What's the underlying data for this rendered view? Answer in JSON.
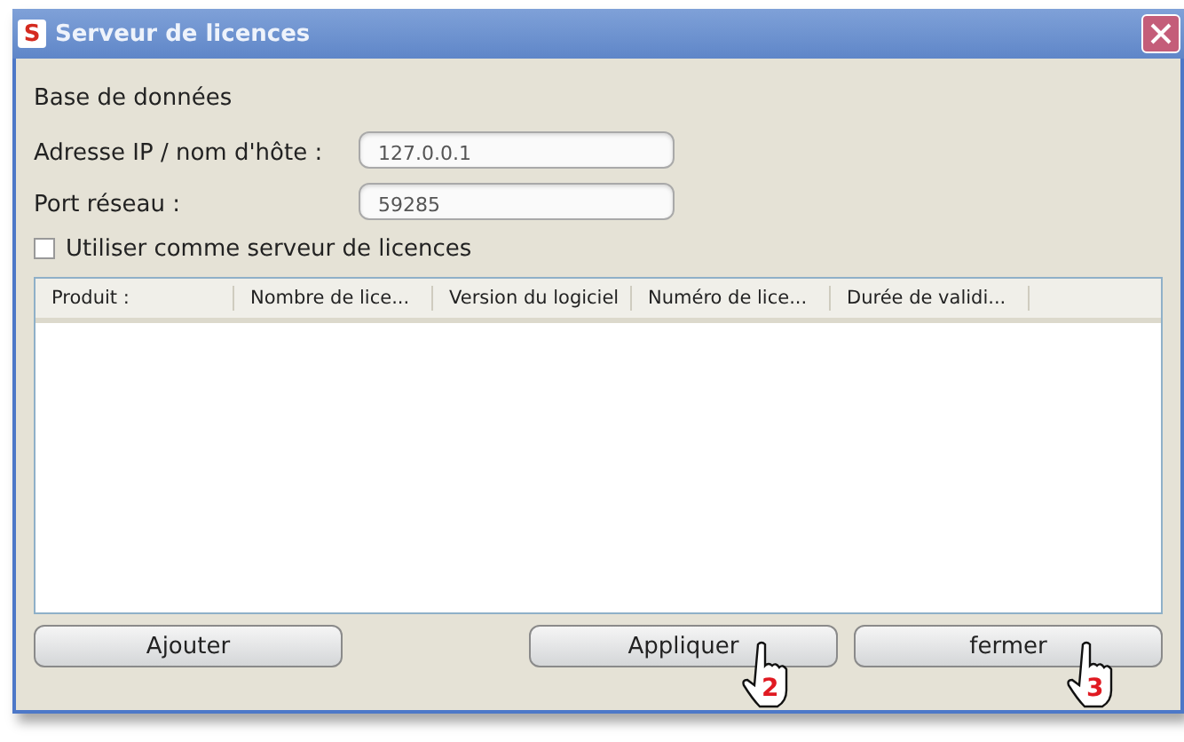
{
  "window": {
    "title": "Serveur de licences",
    "app_icon": "S"
  },
  "section_title": "Base de données",
  "fields": [
    {
      "label": "Adresse IP / nom d'hôte :",
      "value": "127.0.0.1"
    },
    {
      "label": "Port réseau :",
      "value": "59285"
    }
  ],
  "use_as_server": {
    "label": "Utiliser comme serveur de licences",
    "checked": false
  },
  "table": {
    "columns": [
      "Produit :",
      "Nombre de lice...",
      "Version du logiciel",
      "Numéro de lice...",
      "Durée de validi..."
    ]
  },
  "buttons": [
    {
      "label": "Ajouter"
    },
    {
      "label": "Appliquer",
      "callout": "2"
    },
    {
      "label": "fermer",
      "callout": "3"
    }
  ]
}
